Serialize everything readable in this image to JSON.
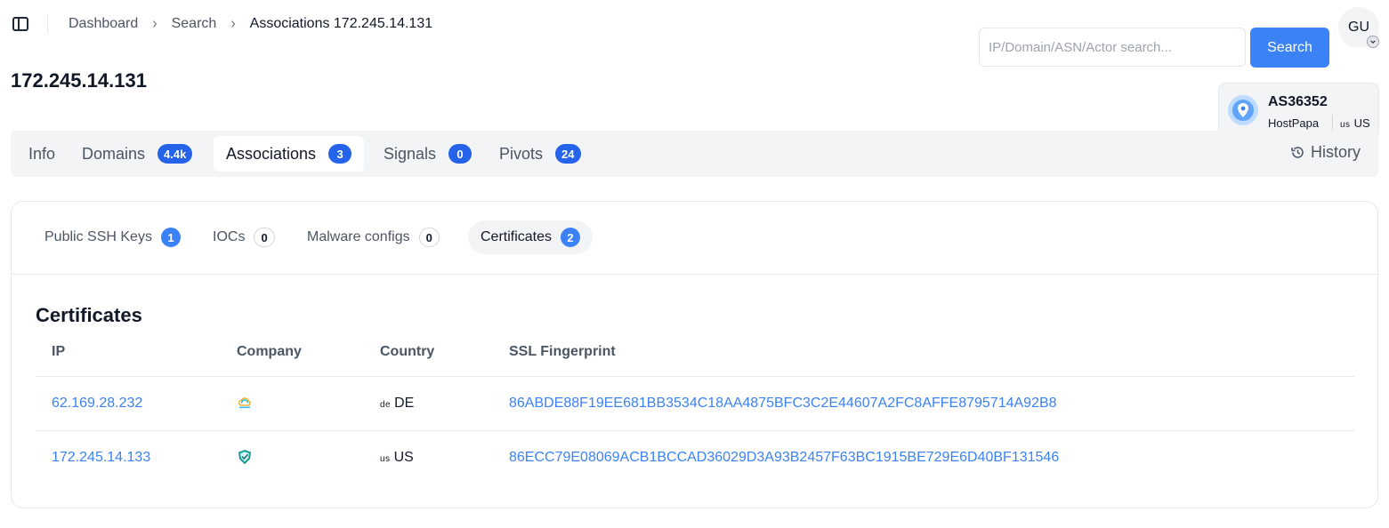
{
  "breadcrumb": [
    "Dashboard",
    "Search",
    "Associations 172.245.14.131"
  ],
  "page_title": "172.245.14.131",
  "search": {
    "placeholder": "IP/Domain/ASN/Actor search...",
    "value": "",
    "button_label": "Search"
  },
  "user": {
    "initials": "GU"
  },
  "asn_card": {
    "asn": "AS36352",
    "provider": "HostPapa",
    "country_code": "us",
    "country": "US"
  },
  "main_tabs": [
    {
      "label": "Info",
      "badge": null
    },
    {
      "label": "Domains",
      "badge": "4.4k"
    },
    {
      "label": "Associations",
      "badge": "3",
      "active": true
    },
    {
      "label": "Signals",
      "badge": "0"
    },
    {
      "label": "Pivots",
      "badge": "24"
    }
  ],
  "history_label": "History",
  "sub_tabs": [
    {
      "label": "Public SSH Keys",
      "badge": "1"
    },
    {
      "label": "IOCs",
      "badge": "0"
    },
    {
      "label": "Malware configs",
      "badge": "0"
    },
    {
      "label": "Certificates",
      "badge": "2",
      "active": true
    }
  ],
  "section_title": "Certificates",
  "table": {
    "columns": [
      "IP",
      "Company",
      "Country",
      "SSL Fingerprint"
    ],
    "rows": [
      {
        "ip": "62.169.28.232",
        "company_icon": "cloud-company-icon",
        "country_code": "de",
        "country": "DE",
        "fingerprint": "86ABDE88F19EE681BB3534C18AA4875BFC3C2E44607A2FC8AFFE8795714A92B8"
      },
      {
        "ip": "172.245.14.133",
        "company_icon": "shield-company-icon",
        "country_code": "us",
        "country": "US",
        "fingerprint": "86ECC79E08069ACB1BCCAD36029D3A93B2457F63BC1915BE729E6D40BF131546"
      }
    ]
  },
  "colors": {
    "accent": "#3b82f6",
    "badge_dark": "#2563eb",
    "tab_bg": "#f3f4f6"
  }
}
